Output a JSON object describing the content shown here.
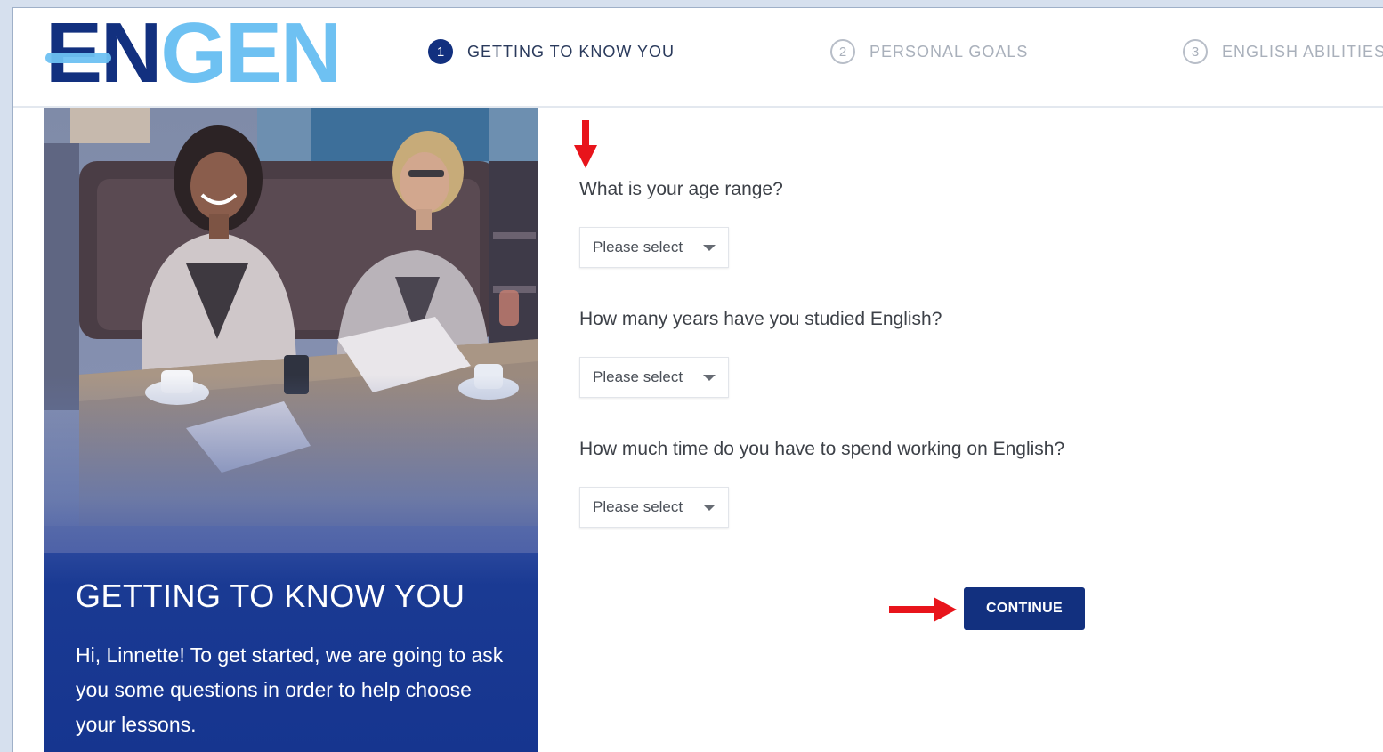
{
  "header": {
    "logo": {
      "part1": "EN",
      "part2": "GEN"
    },
    "steps": [
      {
        "number": "1",
        "label": "GETTING TO KNOW YOU",
        "state": "active"
      },
      {
        "number": "2",
        "label": "PERSONAL GOALS",
        "state": "inactive"
      },
      {
        "number": "3",
        "label": "ENGLISH ABILITIES",
        "state": "inactive"
      }
    ]
  },
  "left_panel": {
    "title": "GETTING TO KNOW YOU",
    "text": "Hi, Linnette! To get started, we are going to ask you some questions in order to help choose your lessons."
  },
  "form": {
    "questions": [
      {
        "label": "What is your age range?",
        "select_value": "Please select"
      },
      {
        "label": "How many years have you studied English?",
        "select_value": "Please select"
      },
      {
        "label": "How much time do you have to spend working on English?",
        "select_value": "Please select"
      }
    ],
    "continue_label": "CONTINUE"
  },
  "colors": {
    "brand_dark": "#12307f",
    "brand_light": "#6ec1f2",
    "annotation_arrow": "#e8141b"
  },
  "icons": {
    "step_active": "filled-circle-number",
    "step_inactive": "outlined-circle-number",
    "dropdown": "caret-down-icon",
    "annotation": "red-arrow-icon"
  }
}
